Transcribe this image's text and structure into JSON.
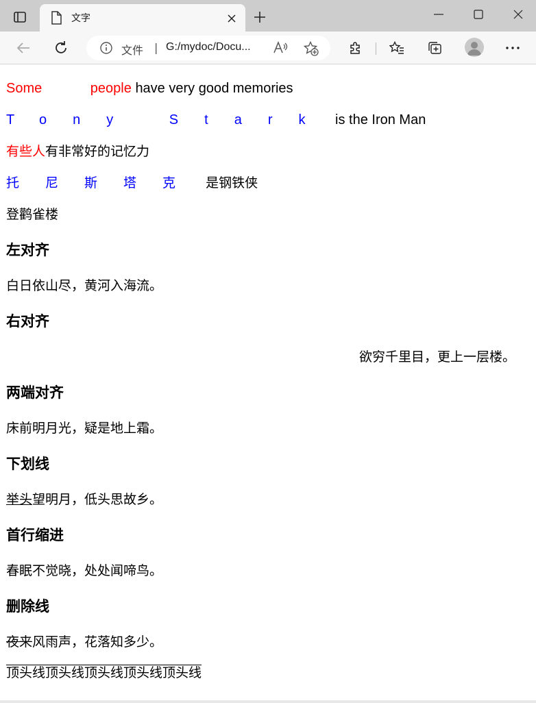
{
  "browser": {
    "tab": {
      "title": "文字"
    },
    "address_bar": {
      "file_label": "文件",
      "separator": "|",
      "url": "G:/mydoc/Docu..."
    },
    "icons": [
      "tab-actions-icon",
      "page-icon",
      "close-icon",
      "plus-icon",
      "minimize-icon",
      "maximize-icon",
      "window-close-icon",
      "back-icon",
      "refresh-icon",
      "info-icon",
      "read-aloud-icon",
      "add-favorite-icon",
      "extensions-icon",
      "favorites-icon",
      "collections-icon",
      "avatar-icon",
      "more-icon"
    ]
  },
  "page": {
    "line1": {
      "colored": "Some people",
      "plain": "have very good memories",
      "color": "#ff0000"
    },
    "line2": {
      "spaced": "Tony Stark",
      "plain": "is the Iron Man",
      "color": "#0000ff"
    },
    "line3": {
      "colored": "有些人",
      "plain": "有非常好的记忆力",
      "color": "#ff0000"
    },
    "line4": {
      "spaced": "托尼斯塔克",
      "plain": "是钢铁侠",
      "color": "#0000ff"
    },
    "line5": {
      "text": "登鹳雀楼"
    },
    "sections": {
      "left": {
        "heading": "左对齐",
        "text": "白日依山尽，黄河入海流。"
      },
      "right": {
        "heading": "右对齐",
        "text": "欲穷千里目，更上一层楼。"
      },
      "justify": {
        "heading": "两端对齐",
        "text": "床前明月光，疑是地上霜。"
      },
      "underline": {
        "heading": "下划线",
        "decorated": "举头",
        "rest": "望明月，低头思故乡。"
      },
      "indent": {
        "heading": "首行缩进",
        "text": "春眠不觉晓，处处闻啼鸟。"
      },
      "strike": {
        "heading": "删除线",
        "decorated": "夜来",
        "rest": "风雨声，花落知多少。"
      }
    },
    "overline": {
      "text": "顶头线顶头线顶头线顶头线顶头线"
    }
  }
}
